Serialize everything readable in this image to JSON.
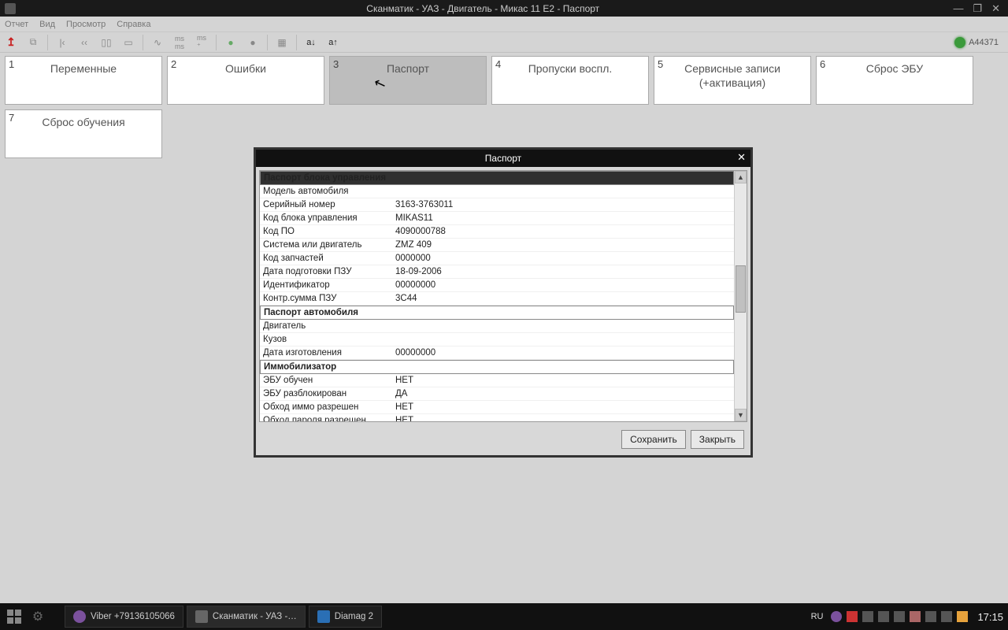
{
  "window": {
    "title": "Сканматик - УАЗ - Двигатель - Микас 11 Е2 - Паспорт",
    "badge": "A44371"
  },
  "menus": {
    "m1": "Отчет",
    "m2": "Вид",
    "m3": "Просмотр",
    "m4": "Справка"
  },
  "tabs": [
    {
      "num": "1",
      "label": "Переменные"
    },
    {
      "num": "2",
      "label": "Ошибки"
    },
    {
      "num": "3",
      "label": "Паспорт"
    },
    {
      "num": "4",
      "label": "Пропуски воспл."
    },
    {
      "num": "5",
      "label": "Сервисные записи (+активация)"
    },
    {
      "num": "6",
      "label": "Сброс ЭБУ"
    },
    {
      "num": "7",
      "label": "Сброс обучения"
    }
  ],
  "dialog": {
    "title": "Паспорт",
    "save": "Сохранить",
    "close": "Закрыть",
    "sections": {
      "s1": "Паспорт блока управления",
      "s2": "Паспорт автомобиля",
      "s3": "Иммобилизатор"
    },
    "rows": [
      {
        "label": "Модель автомобиля",
        "value": ""
      },
      {
        "label": "Серийный номер",
        "value": "3163-3763011"
      },
      {
        "label": "Код блока управления",
        "value": "MIKAS11"
      },
      {
        "label": "Код ПО",
        "value": "4090000788"
      },
      {
        "label": "Система или двигатель",
        "value": "ZMZ 409"
      },
      {
        "label": "Код запчастей",
        "value": "0000000"
      },
      {
        "label": "Дата подготовки ПЗУ",
        "value": "18-09-2006"
      },
      {
        "label": "Идентификатор",
        "value": "00000000"
      },
      {
        "label": "Контр.сумма ПЗУ",
        "value": "3C44"
      }
    ],
    "rows2": [
      {
        "label": "Двигатель",
        "value": ""
      },
      {
        "label": "Кузов",
        "value": ""
      },
      {
        "label": "Дата изготовления",
        "value": "00000000"
      }
    ],
    "rows3": [
      {
        "label": "ЭБУ обучен",
        "value": "НЕТ"
      },
      {
        "label": "ЭБУ разблокирован",
        "value": "ДА"
      },
      {
        "label": "Обход иммо разрешен",
        "value": "НЕТ"
      },
      {
        "label": "Обход пароля разрешен",
        "value": "НЕТ"
      }
    ]
  },
  "taskbar": {
    "lang": "RU",
    "clock": "17:15",
    "apps": {
      "viber": "Viber +79136105066",
      "scan": "Сканматик - УАЗ -…",
      "diamag": "Diamag 2"
    }
  }
}
